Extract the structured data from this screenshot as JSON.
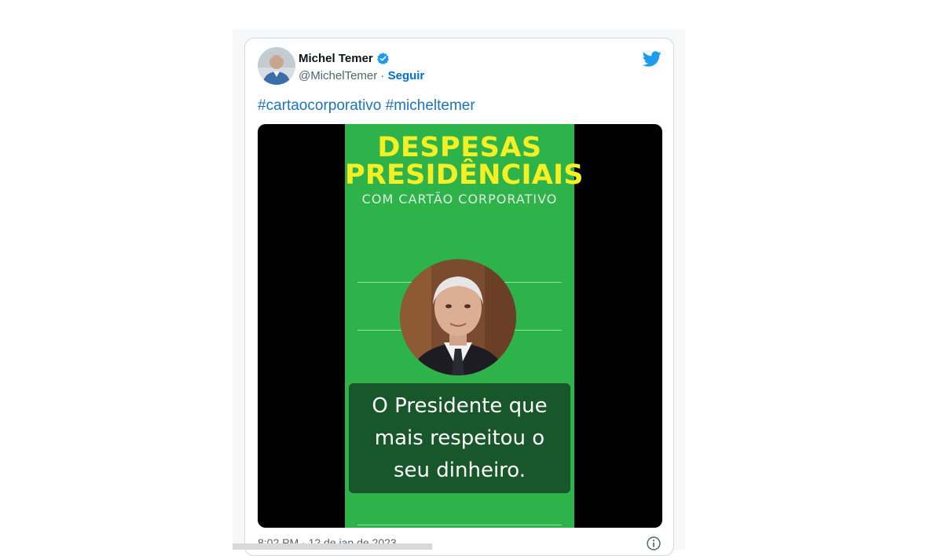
{
  "tweet": {
    "author_name": "Michel Temer",
    "handle": "@MichelTemer",
    "separator": "·",
    "follow_label": "Seguir",
    "hashtags": [
      "#cartaocorporativo",
      "#micheltemer"
    ],
    "timestamp": "8:02 PM · 12 de jan de 2023"
  },
  "media": {
    "title_line1": "DESPESAS",
    "title_line2": "PRESIDÊNCIAIS",
    "subtitle": "COM CARTÃO CORPORATIVO",
    "caption_lines": [
      "O Presidente que",
      "mais respeitou o",
      "seu dinheiro."
    ]
  },
  "colors": {
    "brand": "#1d9bf0",
    "panel_green": "#2db34a",
    "title_yellow": "#f4f024",
    "caption_bg": "#17572a"
  },
  "icons": {
    "verified": "verified-badge-icon",
    "bird": "twitter-bird-icon",
    "info": "info-icon"
  }
}
